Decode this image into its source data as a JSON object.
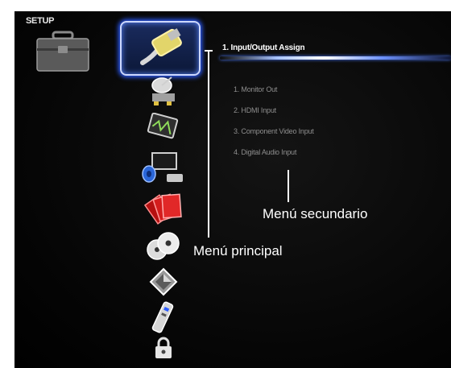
{
  "setup_title": "SETUP",
  "main_menu": {
    "items": [
      {
        "icon": "hdmi-cable-icon",
        "selected": true
      },
      {
        "icon": "satellite-dish-icon",
        "selected": false
      },
      {
        "icon": "monitor-waveform-icon",
        "selected": false
      },
      {
        "icon": "speaker-tv-icon",
        "selected": false
      },
      {
        "icon": "red-cards-icon",
        "selected": false
      },
      {
        "icon": "discs-icon",
        "selected": false
      },
      {
        "icon": "cube-icon",
        "selected": false
      },
      {
        "icon": "remote-control-icon",
        "selected": false
      },
      {
        "icon": "padlock-icon",
        "selected": false
      }
    ]
  },
  "submenu": {
    "title": "1. Input/Output Assign",
    "items": [
      "1. Monitor Out",
      "2. HDMI Input",
      "3. Component Video Input",
      "4. Digital Audio Input"
    ]
  },
  "annotations": {
    "secondary": "Menú secundario",
    "primary": "Menú principal"
  },
  "colors": {
    "background": "#000000",
    "highlight": "#2c5cff",
    "header_text": "#ffffff",
    "item_text": "#8e8e8e"
  }
}
